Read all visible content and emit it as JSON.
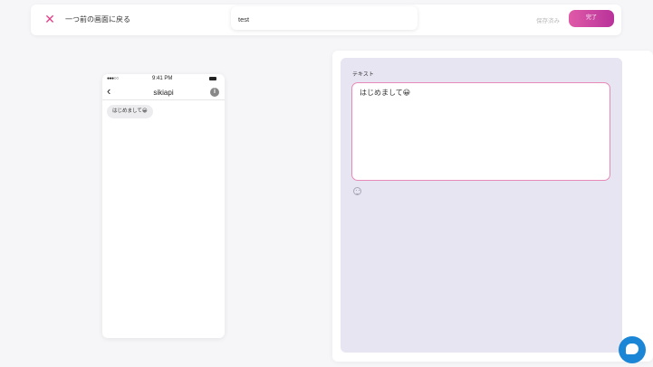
{
  "header": {
    "back_label": "一つ前の画面に戻る",
    "title_value": "test",
    "saved_label": "保存済み",
    "done_label": "完了"
  },
  "preview": {
    "status_signal": "●●●○○",
    "status_time": "9:41 PM",
    "bot_name": "sikiapi",
    "back_glyph": "‹",
    "info_glyph": "i",
    "message": "はじめまして😀"
  },
  "editor": {
    "label": "テキスト",
    "text_value": "はじめまして😀"
  },
  "icons": {
    "close": "close-icon",
    "emoji": "emoji-icon",
    "chat": "chat-icon",
    "info": "info-icon"
  },
  "colors": {
    "accent": "#e0408a",
    "button_gradient_start": "#e05aa8",
    "button_gradient_end": "#b8329a",
    "panel_bg": "#e7e5f2",
    "fab": "#1b86d6"
  }
}
